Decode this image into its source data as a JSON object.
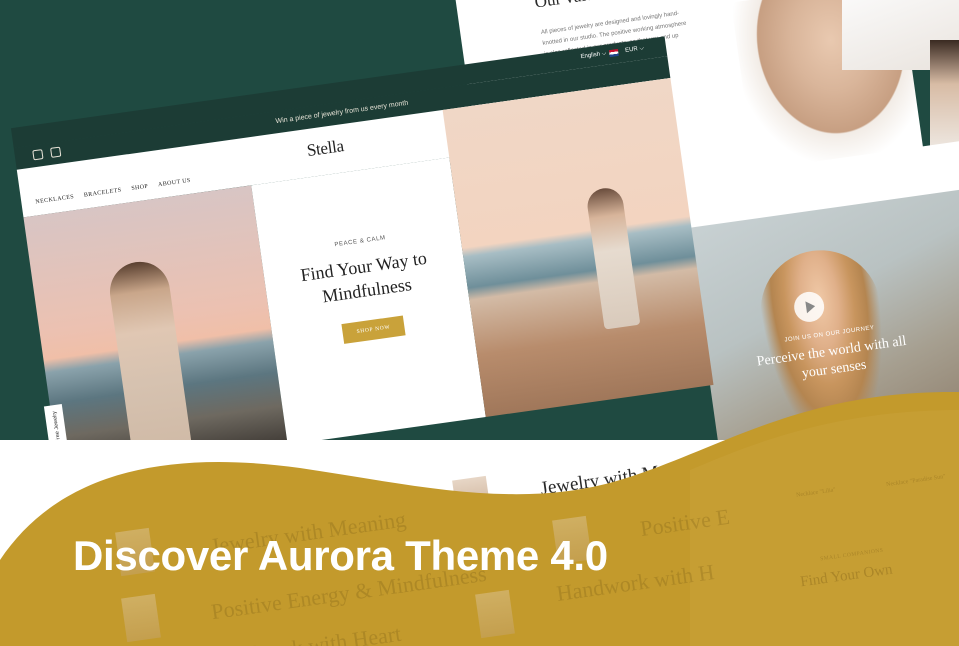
{
  "values_page": {
    "title": "Our values to",
    "text": "All pieces of jewelry are designed and lovingly hand-knotted in our studio. The positive working atmosphere is also reflected in our products, so that you end up holding a piece of jewelry in your"
  },
  "store": {
    "announcement": "Win a piece of jewelry from us every month",
    "language": "English ⌵",
    "currency": "EUR ⌵",
    "logo": "Stella",
    "nav": [
      "NECKLACES",
      "BRACELETS",
      "SHOP",
      "ABOUT US"
    ],
    "hero": {
      "eyebrow": "PEACE & CALM",
      "title": "Find Your Way to Mindfulness",
      "button": "SHOP NOW"
    },
    "side_tab": "Get Free Jewelry"
  },
  "video": {
    "eyebrow": "JOIN US ON OUR JOURNEY",
    "title": "Perceive the world with all your senses"
  },
  "lower": {
    "heading": "Jewelry with Meani",
    "ghost_lines": [
      "Jewelry with Meaning",
      "Positive Energy & Mindfulness",
      "Handwork with Heart",
      "Positive E",
      "Handwork with H"
    ],
    "labels": [
      "Necklace \"Lilia\"",
      "Necklace \"Paradise Sun\"",
      "SMALL COMPANIONS",
      "Find Your Own"
    ]
  },
  "headline": "Discover Aurora Theme 4.0",
  "colors": {
    "background": "#1f4a41",
    "gold": "#c39a2c",
    "announce_bar": "#1c3c35",
    "button": "#c9a23a"
  }
}
